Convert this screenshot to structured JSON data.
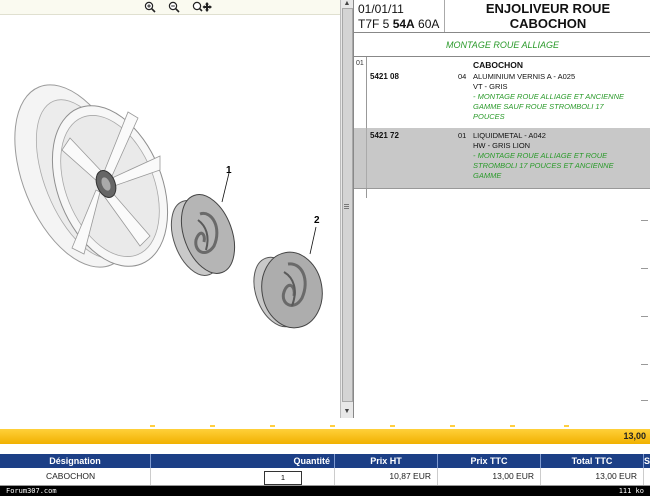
{
  "toolbar": {
    "icons": [
      "zoom-in-icon",
      "zoom-out-icon",
      "zoom-move-icon"
    ]
  },
  "header": {
    "date": "01/01/11",
    "ref_prefix": "T7F 5 ",
    "ref_bold": "54A",
    "ref_suffix": " 60A",
    "title_line1": "ENJOLIVEUR ROUE",
    "title_line2": "CABOCHON",
    "subtitle": "MONTAGE ROUE ALLIAGE"
  },
  "diagram": {
    "label_1": "1",
    "label_2": "2"
  },
  "parts": {
    "group_index": "01",
    "group_caption": "CABOCHON",
    "p1": {
      "ref": "5421 08",
      "qty": "04",
      "line1": "ALUMINIUM VERNIS A - A025",
      "line2": "VT - GRIS",
      "note1": "- MONTAGE ROUE ALLIAGE ET ANCIENNE",
      "note2": "GAMME SAUF ROUE STROMBOLI 17",
      "note3": "POUCES"
    },
    "p2": {
      "ref": "5421 72",
      "qty": "01",
      "line1": "LIQUIDMETAL - A042",
      "line2": "HW - GRIS LION",
      "note1": "- MONTAGE ROUE ALLIAGE ET ROUE",
      "note2": "STROMBOLI 17 POUCES ET ANCIENNE",
      "note3": "GAMME"
    }
  },
  "cart": {
    "grand_total": "13,00",
    "headers": {
      "designation": "Désignation",
      "quantite": "Quantité",
      "prix_ht": "Prix HT",
      "prix_ttc": "Prix TTC",
      "total_ttc": "Total TTC",
      "extra": "S"
    },
    "row": {
      "designation": "CABOCHON",
      "quantite": "1",
      "prix_ht": "10,87 EUR",
      "prix_ttc": "13,00 EUR",
      "total_ttc": "13,00 EUR"
    }
  },
  "footer": {
    "left": "Forum307.com",
    "right": "111 ko"
  },
  "colors": {
    "header_bar": "#1c3f86",
    "yellow_bar": "#f1b100",
    "green_text": "#2a9a2a",
    "selected_row": "#c8c8c8"
  }
}
